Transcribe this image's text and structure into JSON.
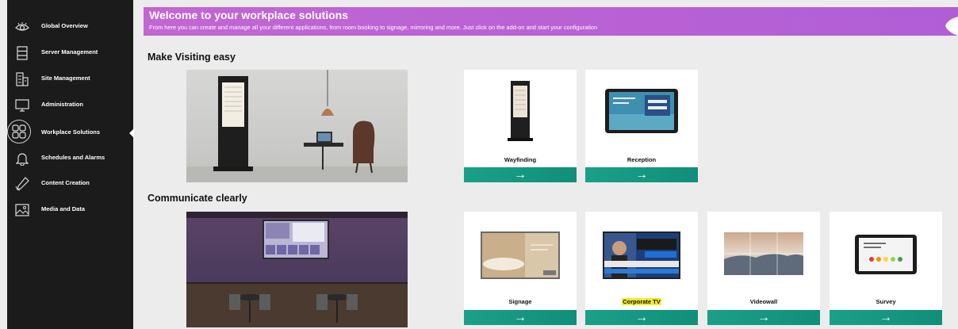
{
  "sidebar": {
    "items": [
      {
        "label": "Global Overview",
        "icon": "eye-icon"
      },
      {
        "label": "Server Management",
        "icon": "server-icon"
      },
      {
        "label": "Site Management",
        "icon": "building-icon"
      },
      {
        "label": "Administration",
        "icon": "monitor-icon"
      },
      {
        "label": "Workplace Solutions",
        "icon": "grid-icon",
        "active": true
      },
      {
        "label": "Schedules and Alarms",
        "icon": "bell-icon"
      },
      {
        "label": "Content Creation",
        "icon": "pen-icon"
      },
      {
        "label": "Media and Data",
        "icon": "image-icon"
      }
    ]
  },
  "banner": {
    "title": "Welcome to your workplace solutions",
    "subtitle": "From here you can create and manage all your different applications, from room booking to signage, mirroring and more. Just click on the add-on and start your configuration"
  },
  "sections": [
    {
      "title": "Make Visiting easy",
      "cards": [
        {
          "label": "Wayfinding"
        },
        {
          "label": "Reception"
        }
      ]
    },
    {
      "title": "Communicate clearly",
      "cards": [
        {
          "label": "Signage"
        },
        {
          "label": "Corporate TV",
          "highlighted": true
        },
        {
          "label": "Videowall"
        },
        {
          "label": "Survey"
        }
      ]
    }
  ],
  "card_action_glyph": "→",
  "colors": {
    "sidebar": "#1b1b1b",
    "banner": "#bf64d4",
    "accent": "#14977f",
    "highlight": "#f6e927"
  }
}
